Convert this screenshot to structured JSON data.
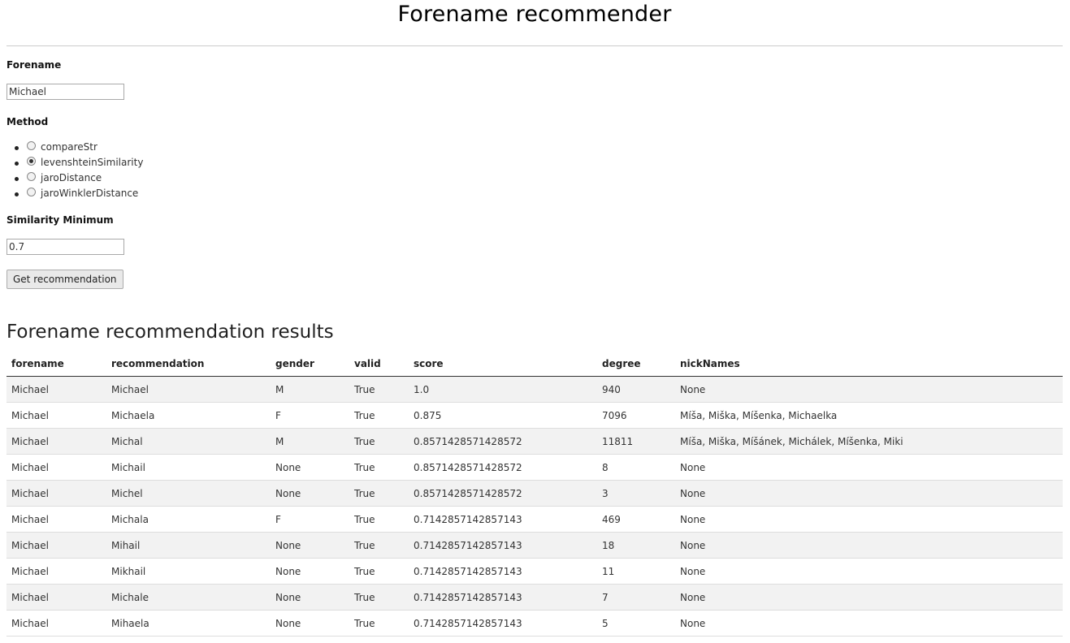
{
  "page": {
    "title": "Forename recommender"
  },
  "form": {
    "forename_label": "Forename",
    "forename_value": "Michael",
    "method_label": "Method",
    "methods": [
      {
        "label": "compareStr",
        "checked": false
      },
      {
        "label": "levenshteinSimilarity",
        "checked": true
      },
      {
        "label": "jaroDistance",
        "checked": false
      },
      {
        "label": "jaroWinklerDistance",
        "checked": false
      }
    ],
    "similarity_label": "Similarity Minimum",
    "similarity_value": "0.7",
    "submit_label": "Get recommendation"
  },
  "results": {
    "heading": "Forename recommendation results",
    "columns": [
      "forename",
      "recommendation",
      "gender",
      "valid",
      "score",
      "degree",
      "nickNames"
    ],
    "rows": [
      [
        "Michael",
        "Michael",
        "M",
        "True",
        "1.0",
        "940",
        "None"
      ],
      [
        "Michael",
        "Michaela",
        "F",
        "True",
        "0.875",
        "7096",
        "Míša, Miška, Míšenka, Michaelka"
      ],
      [
        "Michael",
        "Michal",
        "M",
        "True",
        "0.8571428571428572",
        "11811",
        "Míša, Miška, Míšánek, Michálek, Míšenka, Miki"
      ],
      [
        "Michael",
        "Michail",
        "None",
        "True",
        "0.8571428571428572",
        "8",
        "None"
      ],
      [
        "Michael",
        "Michel",
        "None",
        "True",
        "0.8571428571428572",
        "3",
        "None"
      ],
      [
        "Michael",
        "Michala",
        "F",
        "True",
        "0.7142857142857143",
        "469",
        "None"
      ],
      [
        "Michael",
        "Mihail",
        "None",
        "True",
        "0.7142857142857143",
        "18",
        "None"
      ],
      [
        "Michael",
        "Mikhail",
        "None",
        "True",
        "0.7142857142857143",
        "11",
        "None"
      ],
      [
        "Michael",
        "Michale",
        "None",
        "True",
        "0.7142857142857143",
        "7",
        "None"
      ],
      [
        "Michael",
        "Mihaela",
        "None",
        "True",
        "0.7142857142857143",
        "5",
        "None"
      ]
    ]
  }
}
